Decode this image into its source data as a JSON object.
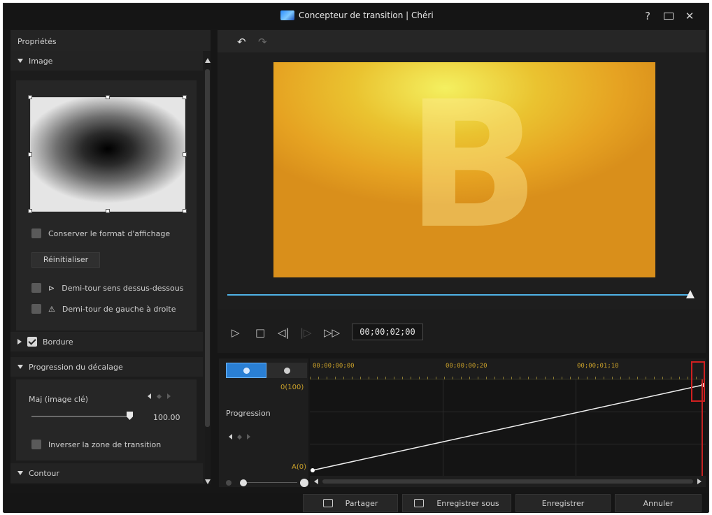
{
  "window": {
    "title": "Concepteur de transition | Chéri",
    "help_glyph": "?",
    "close_glyph": "✕"
  },
  "left_panel": {
    "header": "Propriétés",
    "image_section": {
      "title": "Image",
      "keep_aspect_label": "Conserver le format d'affichage",
      "reset_label": "Réinitialiser",
      "flip_vertical_label": "Demi-tour sens dessus-dessous",
      "flip_horizontal_label": "Demi-tour de gauche à droite"
    },
    "border_section": {
      "title": "Bordure"
    },
    "offset_section": {
      "title": "Progression du décalage",
      "max_label": "Maj (image clé)",
      "value": "100.00",
      "invert_label": "Inverser la zone de transition"
    },
    "contour_section": {
      "title": "Contour"
    }
  },
  "preview": {
    "letter": "B",
    "timecode": "00;00;02;00",
    "scrub_progress": 1.0
  },
  "transport": {
    "play_glyph": "▷",
    "stop_glyph": "□",
    "prev_frame_glyph": "◁|",
    "next_frame_glyph": "|▷",
    "fast_forward_glyph": "▷▷"
  },
  "timeline": {
    "track_label": "Progression",
    "value_top": "0(100)",
    "value_bottom": "A(0)",
    "ruler": [
      "00;00;00;00",
      "00;00;00;20",
      "00;00;01;10"
    ]
  },
  "footer": {
    "share_label": "Partager",
    "save_as_label": "Enregistrer sous",
    "save_label": "Enregistrer",
    "cancel_label": "Annuler"
  }
}
